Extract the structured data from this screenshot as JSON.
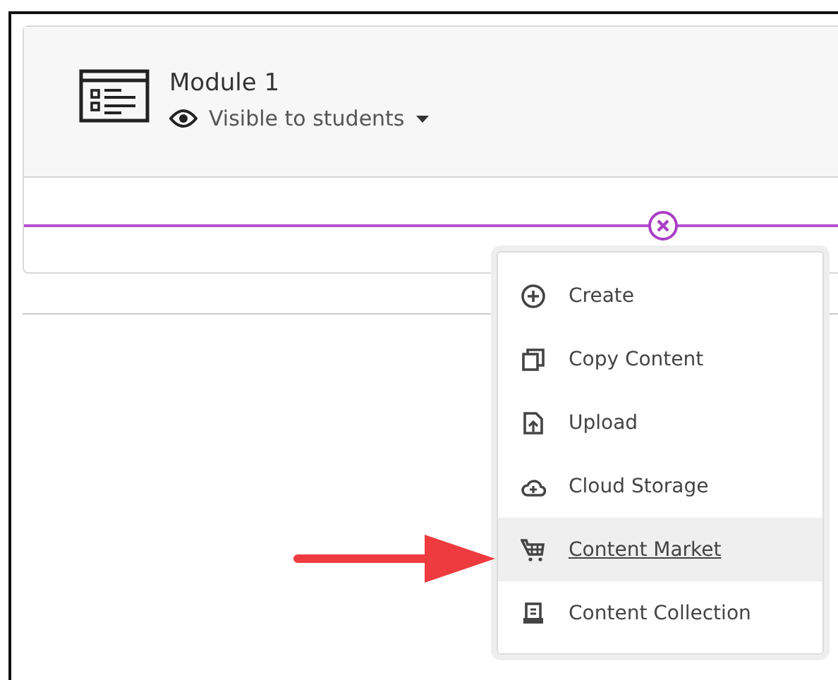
{
  "module": {
    "title": "Module 1",
    "visibility": "Visible to students"
  },
  "menu": {
    "items": [
      {
        "kind": "create",
        "label": "Create",
        "selected": false
      },
      {
        "kind": "copy",
        "label": "Copy Content",
        "selected": false
      },
      {
        "kind": "upload",
        "label": "Upload",
        "selected": false
      },
      {
        "kind": "cloud",
        "label": "Cloud Storage",
        "selected": false
      },
      {
        "kind": "market",
        "label": "Content Market",
        "selected": true
      },
      {
        "kind": "collection",
        "label": "Content Collection",
        "selected": false
      }
    ]
  }
}
